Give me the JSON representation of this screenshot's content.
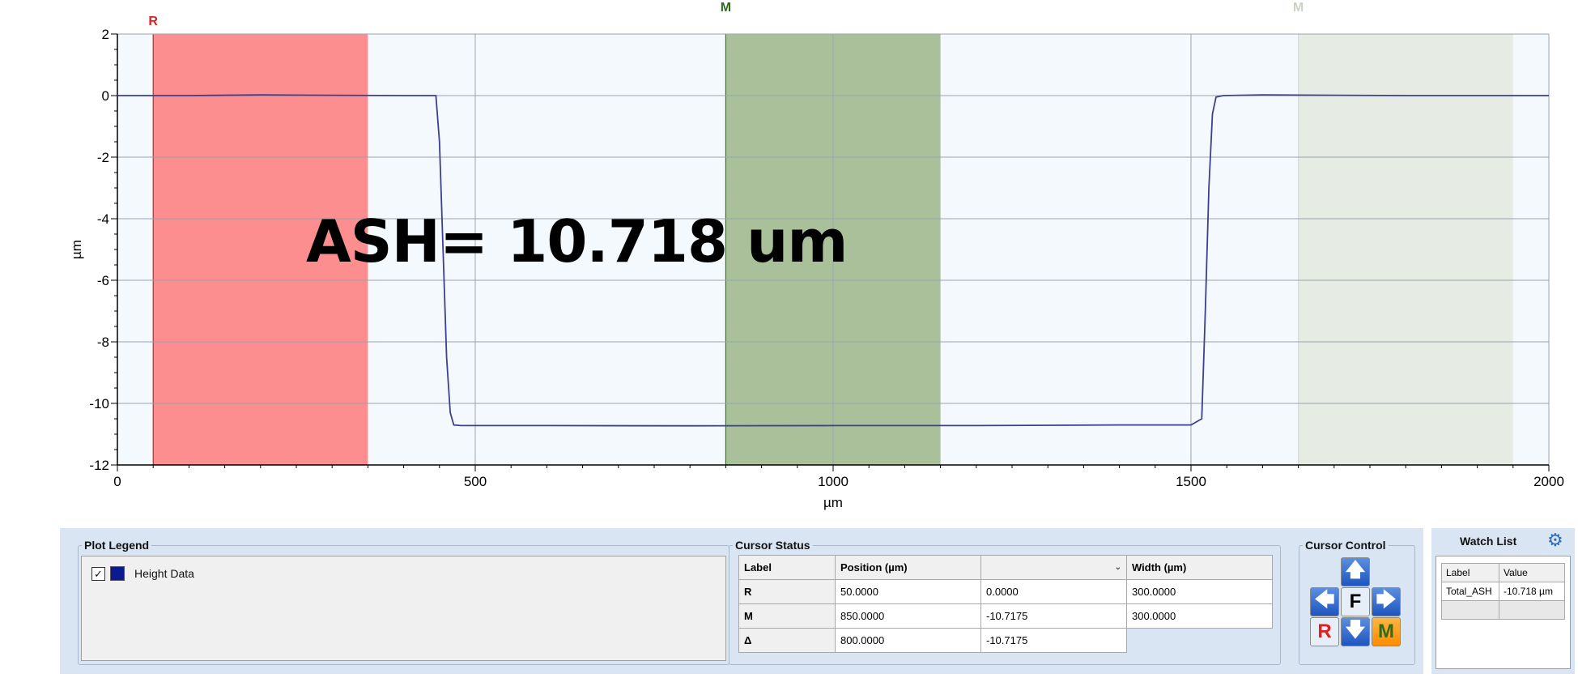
{
  "chart_data": {
    "type": "line",
    "xlabel": "µm",
    "ylabel": "µm",
    "xlim": [
      0,
      2000
    ],
    "ylim": [
      -12,
      2
    ],
    "xticks": [
      0,
      500,
      1000,
      1500,
      2000
    ],
    "yticks": [
      2,
      0,
      -2,
      -4,
      -6,
      -8,
      -10,
      -12
    ],
    "grid": true,
    "series": [
      {
        "name": "Height Data",
        "color": "#3d3f8f",
        "x": [
          0,
          100,
          200,
          300,
          400,
          445,
          450,
          455,
          460,
          465,
          470,
          480,
          600,
          800,
          1000,
          1200,
          1400,
          1500,
          1515,
          1520,
          1525,
          1530,
          1535,
          1545,
          1600,
          1800,
          2000
        ],
        "y": [
          0,
          0,
          0.02,
          0.01,
          0,
          0,
          -1.5,
          -5,
          -8.5,
          -10.3,
          -10.7,
          -10.72,
          -10.72,
          -10.73,
          -10.72,
          -10.72,
          -10.7,
          -10.7,
          -10.5,
          -7,
          -3,
          -0.6,
          -0.05,
          0,
          0.02,
          0,
          0
        ]
      }
    ],
    "cursor_bands": [
      {
        "label": "R",
        "start": 50,
        "end": 350,
        "color": "#fd8e8f",
        "label_color": "#e02020"
      },
      {
        "label": "M",
        "start": 850,
        "end": 1150,
        "color": "#a9c09a",
        "label_color": "#2e6b1b"
      },
      {
        "label": "M",
        "start": 1650,
        "end": 1950,
        "color": "#e6ebe4",
        "label_color": "#c9d3c4"
      }
    ],
    "annotation": "ASH= 10.718 um"
  },
  "colors": {
    "plot_bg": "#f4f9fd",
    "grid": "#9aa3ad"
  },
  "plot_legend": {
    "title": "Plot Legend",
    "items": [
      {
        "label": "Height Data",
        "checked": true,
        "check_glyph": "✓",
        "color": "#0b1a8f"
      }
    ]
  },
  "cursor_status": {
    "title": "Cursor Status",
    "headers": [
      "Label",
      "Position (µm)",
      "",
      "Width (µm)"
    ],
    "dropdown_glyph": "⌄",
    "rows": [
      {
        "label": "R",
        "position": "50.0000",
        "value": "0.0000",
        "width": "300.0000"
      },
      {
        "label": "M",
        "position": "850.0000",
        "value": "-10.7175",
        "width": "300.0000"
      },
      {
        "label": "Δ",
        "position": "800.0000",
        "value": "-10.7175",
        "width": ""
      }
    ]
  },
  "cursor_control": {
    "title": "Cursor Control",
    "up": "🡅",
    "left": "🡄",
    "center": "F",
    "right": "🡆",
    "down": "🡇",
    "r": "R",
    "m": "M"
  },
  "watch_list": {
    "title": "Watch List",
    "settings_icon": "⚙",
    "headers": [
      "Label",
      "Value"
    ],
    "rows": [
      {
        "label": "Total_ASH",
        "value": "-10.718 µm"
      }
    ]
  }
}
